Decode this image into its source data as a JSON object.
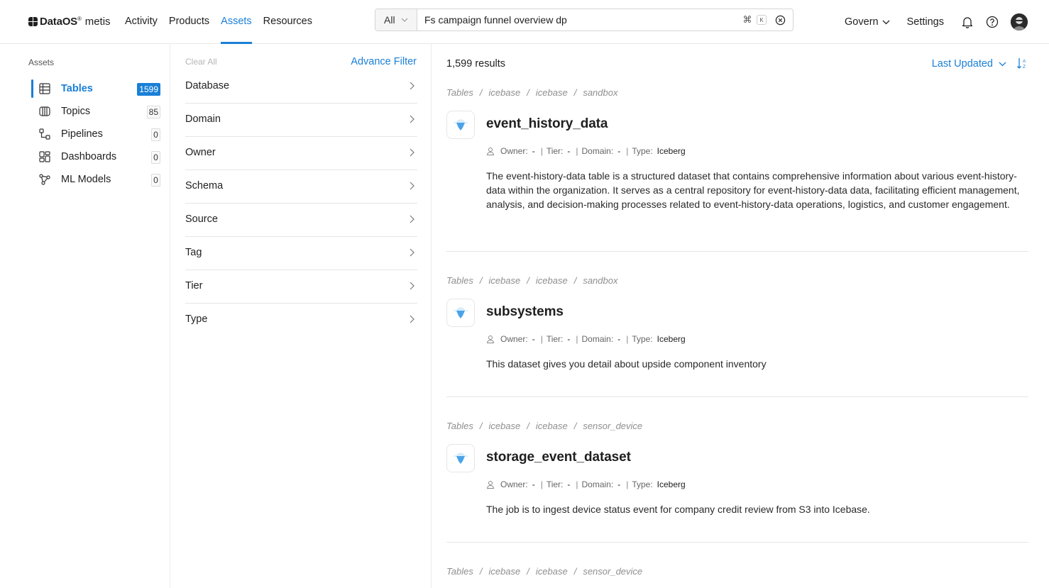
{
  "header": {
    "brand": "DataOS",
    "brand_mark": "®",
    "brand_sub": "metis",
    "nav": [
      {
        "label": "Activity"
      },
      {
        "label": "Products"
      },
      {
        "label": "Assets",
        "active": true
      },
      {
        "label": "Resources"
      }
    ],
    "search": {
      "scope": "All",
      "value": "Fs campaign funnel overview dp",
      "shortcut_cmd": "⌘",
      "shortcut_key": "K"
    },
    "govern_label": "Govern",
    "settings_label": "Settings"
  },
  "sidebar": {
    "title": "Assets",
    "items": [
      {
        "label": "Tables",
        "count": "1599",
        "icon": "table-icon",
        "active": true
      },
      {
        "label": "Topics",
        "count": "85",
        "icon": "topic-icon"
      },
      {
        "label": "Pipelines",
        "count": "0",
        "icon": "pipeline-icon"
      },
      {
        "label": "Dashboards",
        "count": "0",
        "icon": "dashboard-icon"
      },
      {
        "label": "ML Models",
        "count": "0",
        "icon": "ml-model-icon"
      }
    ]
  },
  "filters": {
    "clear_all": "Clear All",
    "advance_filter": "Advance Filter",
    "items": [
      "Database",
      "Domain",
      "Owner",
      "Schema",
      "Source",
      "Tag",
      "Tier",
      "Type"
    ]
  },
  "results": {
    "count_label": "1,599 results",
    "sort_label": "Last Updated",
    "meta_labels": {
      "owner": "Owner:",
      "tier": "Tier:",
      "domain": "Domain:",
      "type": "Type:"
    },
    "items": [
      {
        "crumbs": [
          "Tables",
          "icebase",
          "icebase",
          "sandbox"
        ],
        "name": "event_history_data",
        "owner": "-",
        "tier": "-",
        "domain": "-",
        "type": "Iceberg",
        "description": "The event-history-data table is a structured dataset that contains comprehensive information about various event-history-data within the organization. It serves as a central repository for event-history-data data, facilitating efficient management, analysis, and decision-making processes related to event-history-data operations, logistics, and customer engagement."
      },
      {
        "crumbs": [
          "Tables",
          "icebase",
          "icebase",
          "sandbox"
        ],
        "name": "subsystems",
        "owner": "-",
        "tier": "-",
        "domain": "-",
        "type": "Iceberg",
        "description": "This dataset gives you detail about upside component inventory"
      },
      {
        "crumbs": [
          "Tables",
          "icebase",
          "icebase",
          "sensor_device"
        ],
        "name": "storage_event_dataset",
        "owner": "-",
        "tier": "-",
        "domain": "-",
        "type": "Iceberg",
        "description": "The job is to ingest device status event for company credit review from S3 into Icebase."
      },
      {
        "crumbs": [
          "Tables",
          "icebase",
          "icebase",
          "sensor_device"
        ]
      }
    ]
  },
  "colors": {
    "accent": "#1a7fd6",
    "text": "#1f1f1f",
    "muted": "#8f8f8f"
  }
}
